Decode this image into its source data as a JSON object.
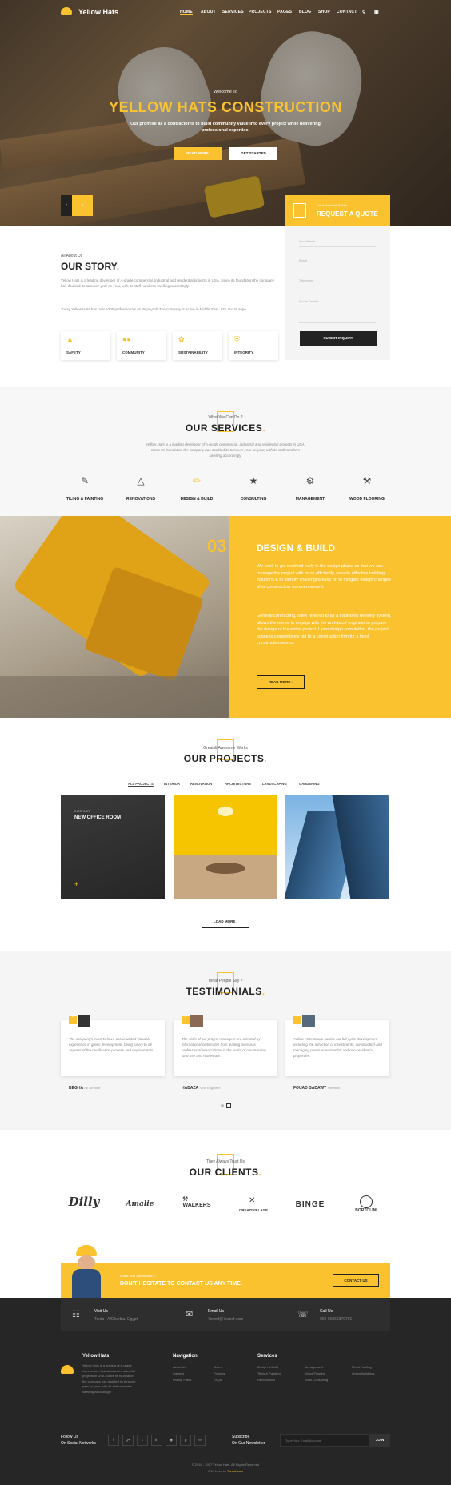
{
  "header": {
    "brand": "Yellow Hats",
    "nav": [
      "HOME",
      "ABOUT",
      "SERVICES",
      "PROJECTS",
      "PAGES",
      "BLOG",
      "SHOP",
      "CONTACT"
    ]
  },
  "hero": {
    "welcome": "Welcome To",
    "title": "YELLOW HATS CONSTRUCTION",
    "text": "Our promise as a contractor is to build community value into every project while delivering professional expertise.",
    "btn_read": "READ MORE",
    "btn_start": "GET STARTED"
  },
  "quote": {
    "small": "Don't Hesitate To Ask",
    "title": "REQUEST A QUOTE",
    "fields": [
      "Your Name",
      "Email",
      "Telephone",
      "Quote Details"
    ],
    "submit": "SUBMIT INQUIRY"
  },
  "story": {
    "eyebrow": "All About Us",
    "title": "OUR STORY",
    "p1": "Yellow Hats is a leading developer of A-grade commercial, industrial and residential projects in USA. Since its foundation the company has doubled its turnover year on year, with its staff numbers swelling accordingly.",
    "p2": "Today Yellow Hats has over a200 professionals on its payroll. The company is active in Middle East, CIS and Europe.",
    "features": [
      "SAFETY",
      "COMMUNITY",
      "SUSTAINABILITY",
      "INTEGRITY"
    ]
  },
  "services": {
    "eyebrow": "What We Can Do ?",
    "title": "OUR SERVICES",
    "text": "Yellow Hats is a leading developer of A-grade commercial, industrial and residential projects in USA. Since its foundation the company has doubled its turnover year on year, with its staff numbers swelling accordingly.",
    "items": [
      "TILING & PAINTING",
      "RENOVATIONS",
      "DESIGN & BUILD",
      "CONSULTING",
      "MANAGEMENT",
      "WOOD FLOORING"
    ]
  },
  "design": {
    "number": "03",
    "title": "DESIGN & BUILD",
    "p1": "We seek to get involved early in the design phase so that we can manage the project with more efficiently, provide effective building solutions & to identify challenges early on to mitigate design changes after construction commencement.",
    "p2": "General contracting, often referred to as a traditional delivery system, allows the owner to engage with the architect / engineer to prepare the design of the entire project. Upon design completion, the project scope is competitively bid to a construction firm for a fixed construction works.",
    "btn": "READ MORE"
  },
  "projects": {
    "eyebrow": "Great & Awesome Works",
    "title": "OUR PROJECTS",
    "filters": [
      "ALL PROJECTS",
      "INTERIOR",
      "RENOVATION",
      "ARCHITECTURE",
      "LANDSCAPING",
      "GARDENING"
    ],
    "first_cat": "INTERIOR",
    "first_name": "NEW OFFICE ROOM",
    "load_more": "LOAD MORE"
  },
  "testimonials": {
    "eyebrow": "What People Say ?",
    "title": "TESTIMONIALS",
    "items": [
      {
        "text": "The company's experts have accumulated valuable experience in green development, being savvy to all aspects of the certification process and requirements.",
        "name": "BEGHA",
        "role": "/UI Director"
      },
      {
        "text": "The skills of our project managers are attested by international certificates from leading overseas professional associations in the realm of construction, land use and real estate.",
        "name": "HABAZA",
        "role": "/Civil Engineer"
      },
      {
        "text": "Yellow Hats Group carries out full-cycle development including the attraction of investments, construction and managing premium residential and non-residential properties.",
        "name": "FOUAD BADAWY",
        "role": "/Investor"
      }
    ]
  },
  "clients": {
    "eyebrow": "They Always Trust Us",
    "title": "OUR CLIENTS",
    "logos": [
      "Dilly",
      "Amalie",
      "WALKERS",
      "CREATIVILLAGE",
      "BINGE",
      "BORTOLINI"
    ]
  },
  "cta": {
    "small": "Have Any Questions ?",
    "title": "DON'T HESITATE TO CONTACT US ANY TIME.",
    "btn": "CONTACT US"
  },
  "contact_bar": [
    {
      "label": "Visit Us",
      "value": "Tanta , AlGharbia, Egypt."
    },
    {
      "label": "Email Us",
      "value": "7oroof@7oroof.com"
    },
    {
      "label": "Call Us",
      "value": "002 01065370701"
    }
  ],
  "footer": {
    "brand": "Yellow Hats",
    "about": "Yellow Hats is a leading of A-grade commercial, industrial and residential projects in USA. Since its foundation the company has doubled its turnover year on year, with its staff numbers swelling accordingly.",
    "nav_title": "Navigation",
    "nav_col1": [
      "About Us",
      "Careers",
      "Pricing Plans"
    ],
    "nav_col2": [
      "Team",
      "Projects",
      "FAQs"
    ],
    "services_title": "Services",
    "svc_col1": [
      "Design & Build",
      "Tiling & Painting",
      "Renovations"
    ],
    "svc_col2": [
      "Management",
      "Wood Flooring",
      "Work Consulting"
    ],
    "svc_col3": [
      "Metal Roofing",
      "Green Buildings"
    ],
    "follow": "Follow Us",
    "follow2": "On Social Networks",
    "subscribe": "Subscribe",
    "subscribe2": "On Our Newsletter",
    "email_placeholder": "Type Your Email Account",
    "join": "JOIN",
    "copyright": "© 2016 - 2017 Yellow Hats. All Rights Reserved",
    "credit_pre": "With Love by",
    "credit": "7oroof.com"
  },
  "colors": {
    "accent": "#f9c22e",
    "dark": "#222222",
    "footer": "#262626"
  }
}
